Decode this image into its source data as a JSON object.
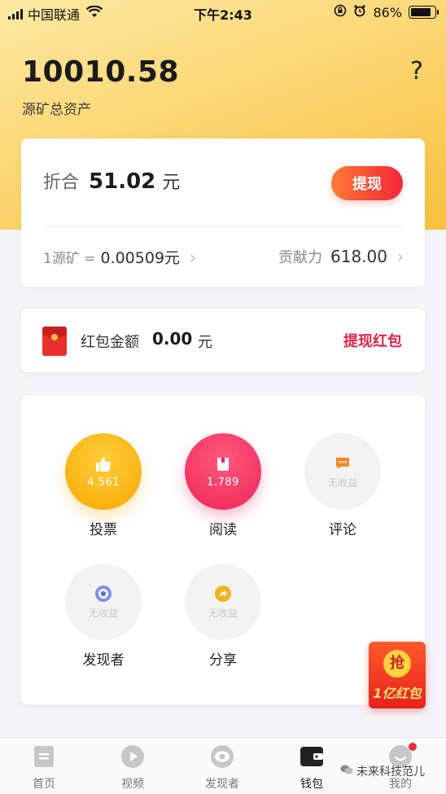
{
  "status_bar": {
    "carrier": "中国联通",
    "time": "下午2:43",
    "battery_percent": "86%",
    "battery_level": 0.86
  },
  "header": {
    "total_assets": "10010.58",
    "total_assets_label": "源矿总资产",
    "help": "?"
  },
  "balance_card": {
    "equiv_label": "折合",
    "equiv_value": "51.02",
    "equiv_unit": "元",
    "withdraw_label": "提现",
    "rate_label": "1源矿 =",
    "rate_value": "0.00509元",
    "contribution_label": "贡献力",
    "contribution_value": "618.00"
  },
  "red_packet": {
    "label": "红包金额",
    "amount": "0.00",
    "unit": "元",
    "withdraw_label": "提现红包"
  },
  "activities": [
    {
      "label": "投票",
      "value": "4.561",
      "icon": "thumbs-up-icon"
    },
    {
      "label": "阅读",
      "value": "1.789",
      "icon": "book-icon"
    },
    {
      "label": "评论",
      "value": "无收益",
      "icon": "comment-icon"
    },
    {
      "label": "发现者",
      "value": "无收益",
      "icon": "eye-icon"
    },
    {
      "label": "分享",
      "value": "无收益",
      "icon": "share-icon"
    }
  ],
  "float_badge": {
    "coin": "抢",
    "text": "1亿红包"
  },
  "tabbar": [
    {
      "label": "首页",
      "icon": "home-doc-icon"
    },
    {
      "label": "视频",
      "icon": "play-icon"
    },
    {
      "label": "发现者",
      "icon": "eye-icon"
    },
    {
      "label": "钱包",
      "icon": "wallet-icon"
    },
    {
      "label": "我的",
      "icon": "profile-icon"
    }
  ],
  "watermark": "未来科技范儿",
  "colors": {
    "accent": "#f4253b",
    "brand_yellow": "#f8c03e",
    "red_link": "#e4234a"
  }
}
